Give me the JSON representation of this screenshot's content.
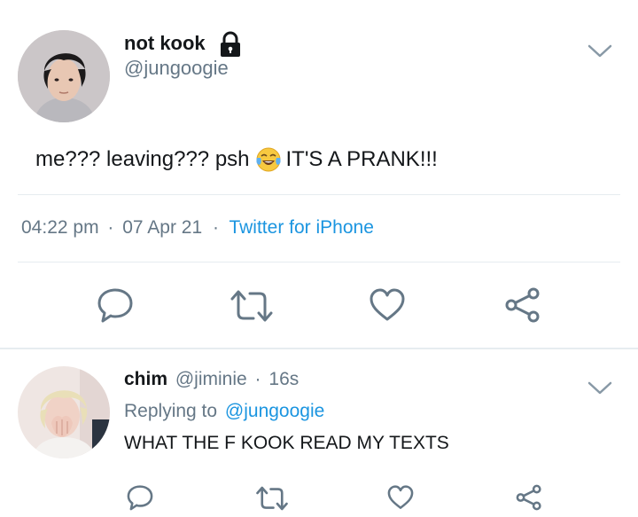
{
  "main_tweet": {
    "author_name": "not kook",
    "handle": "@jungoogie",
    "lock_icon": "lock-icon",
    "text_before_emoji": "me??? leaving??? psh",
    "emoji": "face-with-tears-of-joy",
    "text_after_emoji": "IT'S A PRANK!!!",
    "time": "04:22 pm",
    "date": "07 Apr 21",
    "sep1": "·",
    "sep2": "·",
    "source": "Twitter for iPhone",
    "actions": [
      "reply-icon",
      "retweet-icon",
      "like-icon",
      "share-icon"
    ]
  },
  "reply_tweet": {
    "author_name": "chim",
    "handle": "@jiminie",
    "sep": "·",
    "time_ago": "16s",
    "replying_label": "Replying to",
    "replying_handle": "@jungoogie",
    "text": "WHAT THE F KOOK READ MY TEXTS",
    "actions": [
      "reply-icon",
      "retweet-icon",
      "like-icon",
      "share-icon"
    ]
  },
  "colors": {
    "text": "#14171a",
    "muted": "#657786",
    "link": "#1b95e0",
    "divider": "#e6ecf0",
    "icon": "#657786"
  }
}
